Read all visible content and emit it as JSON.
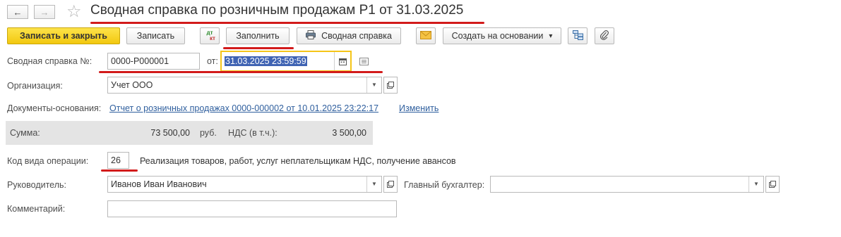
{
  "window": {
    "title": "Сводная справка по розничным продажам Р1 от 31.03.2025"
  },
  "nav": {
    "back_icon": "←",
    "forward_icon": "→",
    "star_icon": "☆"
  },
  "toolbar": {
    "save_close_label": "Записать и закрыть",
    "save_label": "Записать",
    "dtkt_top": "дт",
    "dtkt_bottom": "кт",
    "fill_label": "Заполнить",
    "print_label": "Сводная справка",
    "create_basis_label": "Создать на основании",
    "create_basis_arrow": "▾"
  },
  "form": {
    "number_label": "Сводная справка №:",
    "number_value": "0000-Р000001",
    "date_label": "от:",
    "date_value": "31.03.2025 23:59:59",
    "org_label": "Организация:",
    "org_value": "Учет ООО",
    "basis_label": "Документы-основания:",
    "basis_link": "Отчет о розничных продажах 0000-000002 от 10.01.2025 23:22:17",
    "basis_change": "Изменить",
    "sum_label": "Сумма:",
    "sum_value": "73 500,00",
    "currency": "руб.",
    "vat_label": "НДС (в т.ч.):",
    "vat_value": "3 500,00",
    "op_code_label": "Код вида операции:",
    "op_code_value": "26",
    "op_code_desc": "Реализация товаров, работ, услуг неплательщикам НДС, получение авансов",
    "head_label": "Руководитель:",
    "head_value": "Иванов Иван Иванович",
    "accountant_label": "Главный бухгалтер:",
    "accountant_value": "",
    "comment_label": "Комментарий:",
    "comment_value": ""
  },
  "colors": {
    "accent_yellow": "#f2c80f",
    "annotation_red": "#d21b1b",
    "link_blue": "#2f5f9e"
  }
}
